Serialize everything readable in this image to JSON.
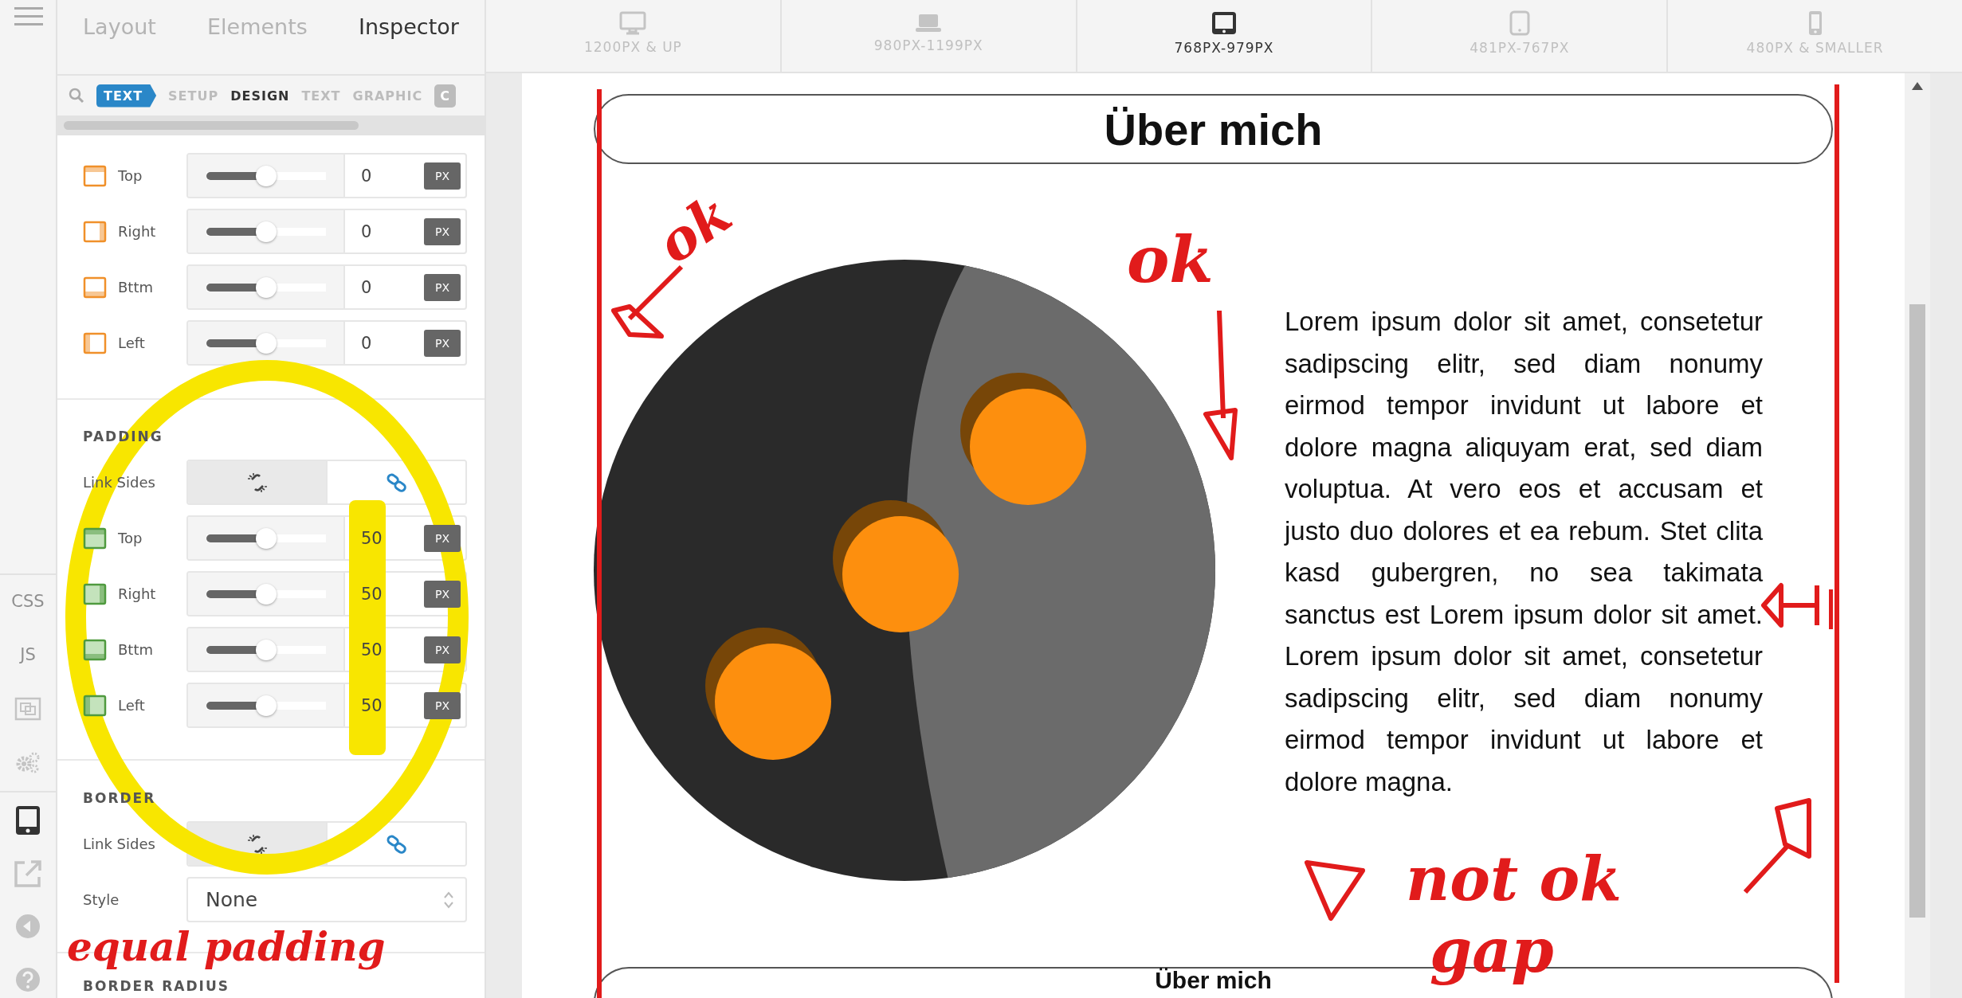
{
  "rail": {
    "items": [
      {
        "kind": "text",
        "label": "CSS",
        "selected": false
      },
      {
        "kind": "text",
        "label": "JS",
        "selected": false
      },
      {
        "kind": "frame",
        "selected": false
      },
      {
        "kind": "gears",
        "selected": false
      },
      {
        "kind": "device",
        "selected": true
      },
      {
        "kind": "export",
        "selected": false
      },
      {
        "kind": "back",
        "selected": false
      },
      {
        "kind": "help",
        "selected": false
      }
    ]
  },
  "inspector": {
    "tabs": [
      {
        "label": "Layout",
        "selected": false
      },
      {
        "label": "Elements",
        "selected": false
      },
      {
        "label": "Inspector",
        "selected": true
      }
    ],
    "element_badge": "TEXT",
    "subtabs": [
      {
        "label": "SETUP",
        "selected": false
      },
      {
        "label": "DESIGN",
        "selected": true
      },
      {
        "label": "TEXT",
        "selected": false
      },
      {
        "label": "GRAPHIC",
        "selected": false
      }
    ],
    "overflow_chip": "C",
    "sections": [
      {
        "kind": "margin",
        "rows": [
          {
            "label": "Top",
            "kind": "top",
            "level": 0.5,
            "value": "0",
            "unit": "PX"
          },
          {
            "label": "Right",
            "kind": "right",
            "level": 0.5,
            "value": "0",
            "unit": "PX"
          },
          {
            "label": "Bttm",
            "kind": "bottom",
            "level": 0.5,
            "value": "0",
            "unit": "PX"
          },
          {
            "label": "Left",
            "kind": "left",
            "level": 0.5,
            "value": "0",
            "unit": "PX"
          }
        ]
      },
      {
        "kind": "padding",
        "title": "PADDING",
        "link_sides": {
          "label": "Link Sides",
          "options": [
            {
              "kind": "unlink",
              "selected": false
            },
            {
              "kind": "link",
              "selected": true
            }
          ]
        },
        "rows": [
          {
            "label": "Top",
            "kind": "top",
            "level": 0.5,
            "value": "50",
            "unit": "PX"
          },
          {
            "label": "Right",
            "kind": "right",
            "level": 0.5,
            "value": "50",
            "unit": "PX"
          },
          {
            "label": "Bttm",
            "kind": "bottom",
            "level": 0.5,
            "value": "50",
            "unit": "PX"
          },
          {
            "label": "Left",
            "kind": "left",
            "level": 0.5,
            "value": "50",
            "unit": "PX"
          }
        ]
      },
      {
        "kind": "border",
        "title": "BORDER",
        "link_sides": {
          "label": "Link Sides",
          "options": [
            {
              "kind": "unlink",
              "selected": false
            },
            {
              "kind": "link",
              "selected": true
            }
          ]
        },
        "style": {
          "label": "Style",
          "value": "None"
        }
      },
      {
        "kind": "radius",
        "title": "BORDER RADIUS"
      }
    ]
  },
  "devices": [
    {
      "label": "1200PX & UP",
      "kind": "monitor",
      "selected": false
    },
    {
      "label": "980PX-1199PX",
      "kind": "laptop",
      "selected": false
    },
    {
      "label": "768PX-979PX",
      "kind": "tablet-landscape",
      "selected": true
    },
    {
      "label": "481PX-767PX",
      "kind": "tablet",
      "selected": false
    },
    {
      "label": "480PX & SMALLER",
      "kind": "phone",
      "selected": false
    }
  ],
  "page": {
    "heading": "Über mich",
    "body": "Lorem ipsum dolor sit amet, consetetur sadipscing elitr, sed diam nonumy eirmod tempor invidunt ut labore et dolore magna aliquyam erat, sed diam voluptua. At vero eos et accusam et justo duo dolores et ea rebum. Stet clita kasd gubergren, no sea takimata sanctus est Lorem ipsum dolor sit amet. Lorem ipsum dolor sit amet, consetetur sadipscing elitr, sed diam nonumy eirmod tempor invidunt ut labore et dolore magna.",
    "next_heading": "Über mich"
  },
  "annotations": {
    "notes": [
      {
        "text": "ok"
      },
      {
        "text": "ok"
      },
      {
        "text": "not ok"
      },
      {
        "text": "gap"
      },
      {
        "text": "equal padding"
      }
    ]
  }
}
